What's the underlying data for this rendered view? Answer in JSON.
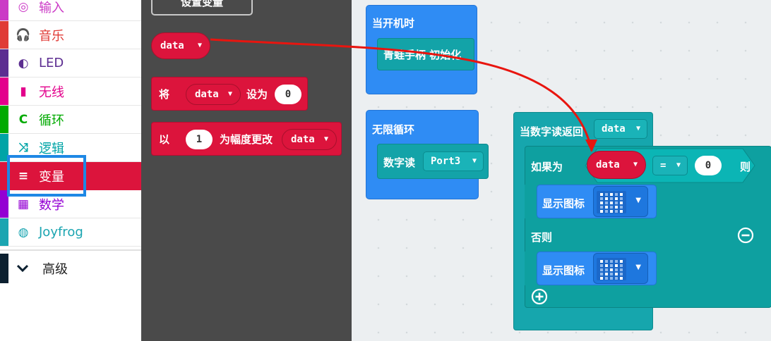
{
  "sidebar": {
    "items": [
      {
        "label": "输入",
        "icon": "target-icon",
        "glyph": "◎",
        "color": "#cb3ac6"
      },
      {
        "label": "音乐",
        "icon": "headphones-icon",
        "glyph": "🎧",
        "color": "#e03b36"
      },
      {
        "label": "LED",
        "icon": "toggle-icon",
        "glyph": "◐",
        "color": "#5c2d91"
      },
      {
        "label": "无线",
        "icon": "signal-bars-icon",
        "glyph": "▮",
        "color": "#e3008c"
      },
      {
        "label": "循环",
        "icon": "loop-icon",
        "glyph": "C",
        "color": "#00aa00"
      },
      {
        "label": "逻辑",
        "icon": "shuffle-icon",
        "glyph": "⤨",
        "color": "#00a4a6"
      },
      {
        "label": "变量",
        "icon": "lines-icon",
        "glyph": "≡",
        "color": "#dc143c"
      },
      {
        "label": "数学",
        "icon": "calculator-icon",
        "glyph": "▦",
        "color": "#9400d3"
      },
      {
        "label": "Joyfrog",
        "icon": "gamepad-icon",
        "glyph": "◍",
        "color": "#1ba5b1"
      }
    ],
    "selected_index": 6,
    "advanced_label": "高级"
  },
  "flyout": {
    "make_variable_label": "设置变量",
    "variable_name": "data",
    "set_block": {
      "prefix": "将",
      "var": "data",
      "mid": "设为",
      "value": "0"
    },
    "change_block": {
      "prefix": "以",
      "value": "1",
      "mid": "为幅度更改",
      "var": "data"
    }
  },
  "workspace": {
    "on_start": {
      "label": "当开机时",
      "inner_label": "青蛙手柄 初始化"
    },
    "forever": {
      "label": "无限循环",
      "inner_label": "数字读",
      "port": "Port3"
    },
    "on_digital_read": {
      "label": "当数字读返回",
      "var": "data",
      "if_label": "如果为",
      "cond_var": "data",
      "operator": "=",
      "cond_value": "0",
      "then_label": "则",
      "else_label": "否则",
      "show_icon_label_1": "显示图标",
      "show_icon_label_2": "显示图标",
      "icon_1_rows": [
        "10101",
        "01010",
        "10101",
        "01010",
        "10101"
      ],
      "icon_2_rows": [
        "10001",
        "01010",
        "00100",
        "01010",
        "10001"
      ]
    }
  },
  "colors": {
    "variables": "#dc143c",
    "events": "#2f8cf4",
    "joyfrog": "#13a3a8",
    "annotation": "#1e88e5",
    "arrow": "#e8150f"
  }
}
